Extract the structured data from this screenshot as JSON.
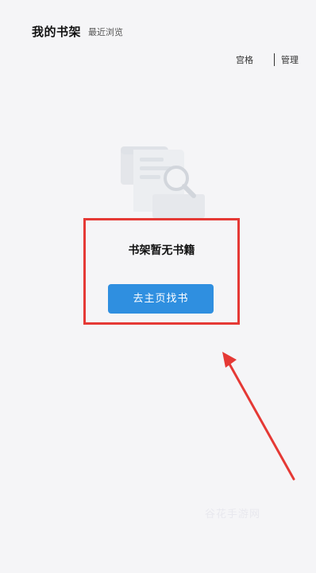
{
  "header": {
    "title": "我的书架",
    "recent_tab": "最近浏览"
  },
  "toolbar": {
    "grid_label": "宫格",
    "manage_label": "管理"
  },
  "empty_state": {
    "message": "书架暂无书籍",
    "button_label": "去主页找书"
  },
  "colors": {
    "accent": "#2f8fe0",
    "annotation_red": "#e53935",
    "background": "#f5f5f7"
  },
  "watermark": {
    "text": "谷花手游网"
  }
}
